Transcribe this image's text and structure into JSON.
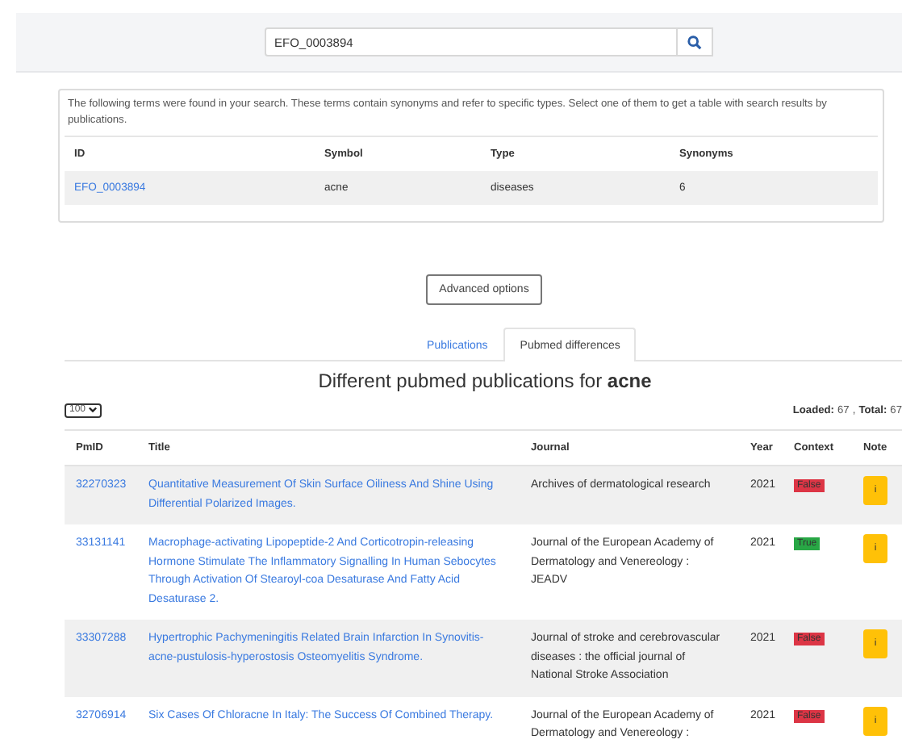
{
  "search": {
    "value": "EFO_0003894"
  },
  "terms": {
    "intro": "The following terms were found in your search. These terms contain synonyms and refer to specific types. Select one of them to get a table with search results by publications.",
    "columns": [
      "ID",
      "Symbol",
      "Type",
      "Synonyms"
    ],
    "rows": [
      {
        "id": "EFO_0003894",
        "symbol": "acne",
        "type": "diseases",
        "synonyms": "6"
      }
    ]
  },
  "advanced_button": "Advanced options",
  "tabs": [
    {
      "label": "Publications",
      "selected": false
    },
    {
      "label": "Pubmed differences",
      "selected": true
    }
  ],
  "heading": "Different pubmed publications for **acne**",
  "page_size": "100",
  "loaded_label": "Loaded:",
  "loaded": "67",
  "separator": ",",
  "total_label": "Total:",
  "total": "67",
  "table": {
    "columns": [
      "PmID",
      "Title",
      "Journal",
      "Year",
      "Context",
      "Note"
    ],
    "rows": [
      {
        "pmid": "32270323",
        "title": "Quantitative Measurement Of Skin Surface Oiliness And Shine Using Differential Polarized Images.",
        "journal": "Archives of dermatological research",
        "year": "2021",
        "context": "False",
        "color": "#dc3545",
        "note": "i"
      },
      {
        "pmid": "33131141",
        "title": "Macrophage-activating Lipopeptide-2 And Corticotropin-releasing Hormone Stimulate The Inflammatory Signalling In Human Sebocytes Through Activation Of Stearoyl-coa Desaturase And Fatty Acid Desaturase 2.",
        "journal": "Journal of the European Academy of Dermatology and Venereology : JEADV",
        "year": "2021",
        "context": "True",
        "color": "#28a745",
        "note": "i"
      },
      {
        "pmid": "33307288",
        "title": "Hypertrophic Pachymeningitis Related Brain Infarction In Synovitis-acne-pustulosis-hyperostosis Osteomyelitis Syndrome.",
        "journal": "Journal of stroke and cerebrovascular diseases : the official journal of National Stroke Association",
        "year": "2021",
        "context": "False",
        "color": "#dc3545",
        "note": "i"
      },
      {
        "pmid": "32706914",
        "title": "Six Cases Of Chloracne In Italy: The Success Of Combined Therapy.",
        "journal": "Journal of the European Academy of Dermatology and Venereology :",
        "year": "2021",
        "context": "False",
        "color": "#dc3545",
        "note": "i"
      }
    ]
  }
}
